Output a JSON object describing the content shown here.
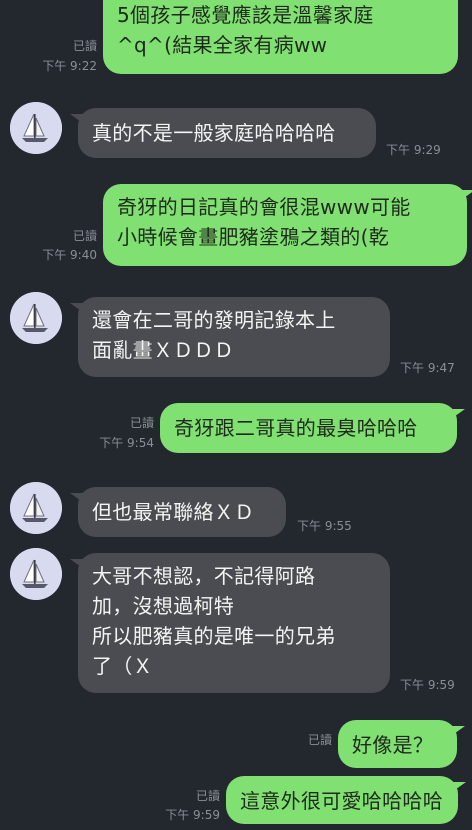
{
  "colors": {
    "background": "#23272e",
    "outgoing_bubble": "#80e071",
    "incoming_bubble": "#4a4c51",
    "meta_text": "#8a8f96",
    "avatar_bg": "#d8dbf0"
  },
  "messages": [
    {
      "dir": "out",
      "lines": [
        "5個孩子感覺應該是溫馨家庭",
        "^q^(結果全家有病ww"
      ],
      "read": "已讀",
      "time": "下午 9:22"
    },
    {
      "dir": "in",
      "lines": [
        "真的不是一般家庭哈哈哈哈"
      ],
      "time": "下午 9:29",
      "avatar": "sailboat-avatar"
    },
    {
      "dir": "out",
      "lines": [
        "奇犽的日記真的會很混www可能",
        "小時候會畫肥豬塗鴉之類的(乾"
      ],
      "read": "已讀",
      "time": "下午 9:40"
    },
    {
      "dir": "in",
      "lines": [
        "還會在二哥的發明記錄本上",
        "面亂畫ＸＤＤＤ"
      ],
      "time": "下午 9:47",
      "avatar": "sailboat-avatar"
    },
    {
      "dir": "out",
      "lines": [
        "奇犽跟二哥真的最臭哈哈哈"
      ],
      "read": "已讀",
      "time": "下午 9:54"
    },
    {
      "dir": "in",
      "lines": [
        "但也最常聯絡ＸＤ"
      ],
      "time": "下午 9:55",
      "avatar": "sailboat-avatar"
    },
    {
      "dir": "in",
      "lines": [
        "大哥不想認，不記得阿路",
        "加，沒想過柯特",
        "所以肥豬真的是唯一的兄弟",
        "了（Ｘ"
      ],
      "time": "下午 9:59",
      "avatar": "sailboat-avatar"
    },
    {
      "dir": "out",
      "lines": [
        "好像是？"
      ],
      "read": "已讀",
      "time": ""
    },
    {
      "dir": "out",
      "lines": [
        "這意外很可愛哈哈哈哈"
      ],
      "read": "已讀",
      "time": "下午 9:59"
    }
  ]
}
